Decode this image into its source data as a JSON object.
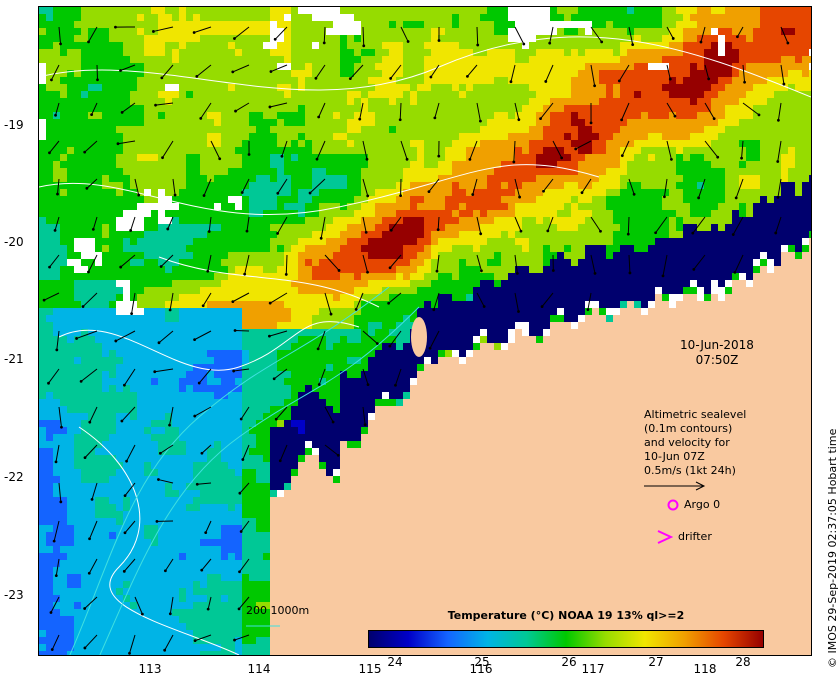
{
  "map": {
    "lat_ticks": [
      "-19",
      "-20",
      "-21",
      "-22",
      "-23"
    ],
    "lon_ticks": [
      "113",
      "114",
      "115",
      "116",
      "117",
      "118"
    ],
    "land_color": "#f9c9a0",
    "no_data_color": "#ffffff",
    "sea_colors": [
      "#00006e",
      "#0000c8",
      "#1464ff",
      "#00b4e6",
      "#00c896",
      "#00c800",
      "#96dc00",
      "#f0e600",
      "#f0a000",
      "#e64600",
      "#960000"
    ]
  },
  "timestamp": {
    "date": "10-Jun-2018",
    "time": "07:50Z"
  },
  "altimetry_legend": {
    "line1": "Altimetric sealevel",
    "line2": "(0.1m contours)",
    "line3": "and velocity for",
    "line4": "10-Jun 07Z",
    "line5": "0.5m/s (1kt 24h)"
  },
  "markers": {
    "argo_label": "Argo 0",
    "drifter_label": "drifter",
    "marker_color": "#ff00ff"
  },
  "colorbar": {
    "title": "Temperature (°C) NOAA 19 13% ql>=2",
    "labels": [
      "24",
      "25",
      "26",
      "27",
      "28"
    ]
  },
  "depth_legend": {
    "label": "200  1000m"
  },
  "credit": "© IMOS 29-Sep-2019 02:37:05 Hobart time"
}
